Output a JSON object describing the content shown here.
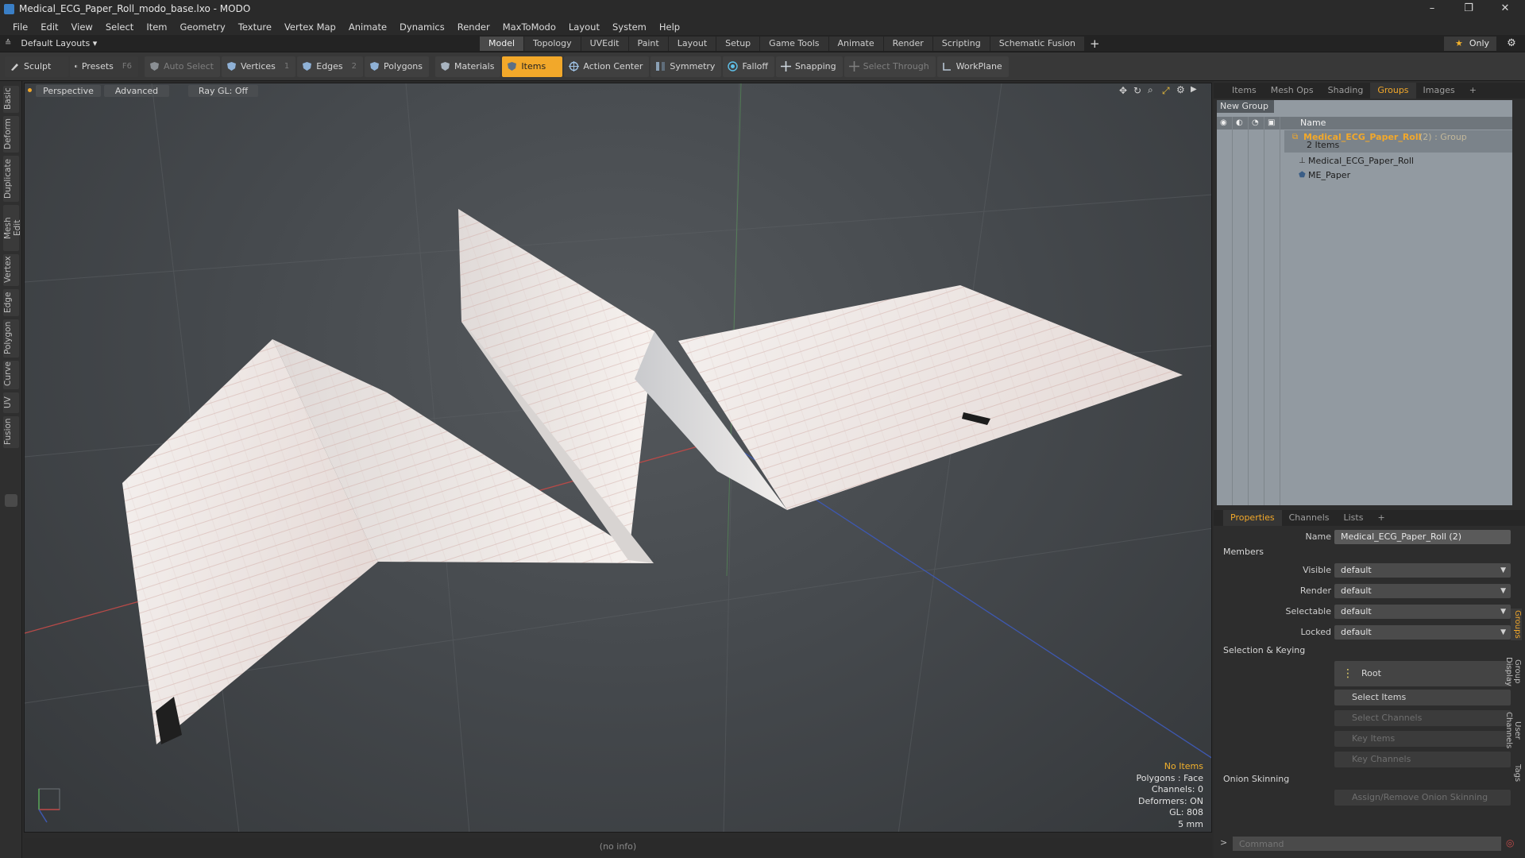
{
  "window": {
    "title": "Medical_ECG_Paper_Roll_modo_base.lxo - MODO",
    "minimize": "–",
    "restore": "❐",
    "close": "✕"
  },
  "menu": [
    "File",
    "Edit",
    "View",
    "Select",
    "Item",
    "Geometry",
    "Texture",
    "Vertex Map",
    "Animate",
    "Dynamics",
    "Render",
    "MaxToModo",
    "Layout",
    "System",
    "Help"
  ],
  "layout_dropdown": "Default Layouts ▾",
  "layout_tabs": [
    "Model",
    "Topology",
    "UVEdit",
    "Paint",
    "Layout",
    "Setup",
    "Game Tools",
    "Animate",
    "Render",
    "Scripting",
    "Schematic Fusion"
  ],
  "layout_tab_active": "Model",
  "layout_plus": "+",
  "only_label": "Only",
  "toolbar": {
    "sculpt": "Sculpt",
    "presets": "Presets",
    "presets_shortcut": "F6",
    "auto_select": "Auto Select",
    "vertices": "Vertices",
    "vertices_count": "1",
    "edges": "Edges",
    "edges_count": "2",
    "polygons": "Polygons",
    "materials": "Materials",
    "items": "Items",
    "action_center": "Action Center",
    "symmetry": "Symmetry",
    "falloff": "Falloff",
    "snapping": "Snapping",
    "select_through": "Select Through",
    "workplane": "WorkPlane"
  },
  "left_tabs": [
    "Basic",
    "Deform",
    "Duplicate",
    "Mesh Edit",
    "Vertex",
    "Edge",
    "Polygon",
    "Curve",
    "UV",
    "Fusion"
  ],
  "viewport": {
    "perspective": "Perspective",
    "advanced": "Advanced",
    "raygl": "Ray GL: Off",
    "info": {
      "no_items": "No Items",
      "polygons": "Polygons : Face",
      "channels": "Channels: 0",
      "deformers": "Deformers: ON",
      "gl": "GL: 808",
      "units": "5 mm"
    }
  },
  "status_bar": "(no info)",
  "right_top_tabs": [
    "Items",
    "Mesh Ops",
    "Shading",
    "Groups",
    "Images"
  ],
  "right_top_active": "Groups",
  "groups": {
    "new_group": "New Group",
    "col_name": "Name",
    "group_name": "Medical_ECG_Paper_Roll",
    "group_suffix": "(2) : Group",
    "group_count": "2 Items",
    "children": [
      "Medical_ECG_Paper_Roll",
      "ME_Paper"
    ]
  },
  "right_bottom_tabs": [
    "Properties",
    "Channels",
    "Lists"
  ],
  "right_bottom_active": "Properties",
  "properties": {
    "name_label": "Name",
    "name_value": "Medical_ECG_Paper_Roll (2)",
    "members": "Members",
    "visible_label": "Visible",
    "visible_value": "default",
    "render_label": "Render",
    "render_value": "default",
    "selectable_label": "Selectable",
    "selectable_value": "default",
    "locked_label": "Locked",
    "locked_value": "default",
    "selection_keying": "Selection & Keying",
    "root": "Root",
    "select_items": "Select Items",
    "select_channels": "Select Channels",
    "key_items": "Key Items",
    "key_channels": "Key Channels",
    "onion_skinning": "Onion Skinning",
    "assign_onion": "Assign/Remove Onion Skinning"
  },
  "right_side_tabs": [
    "Groups",
    "Group Display",
    "User Channels",
    "Tags"
  ],
  "command": {
    "prompt": ">",
    "placeholder": "Command"
  }
}
